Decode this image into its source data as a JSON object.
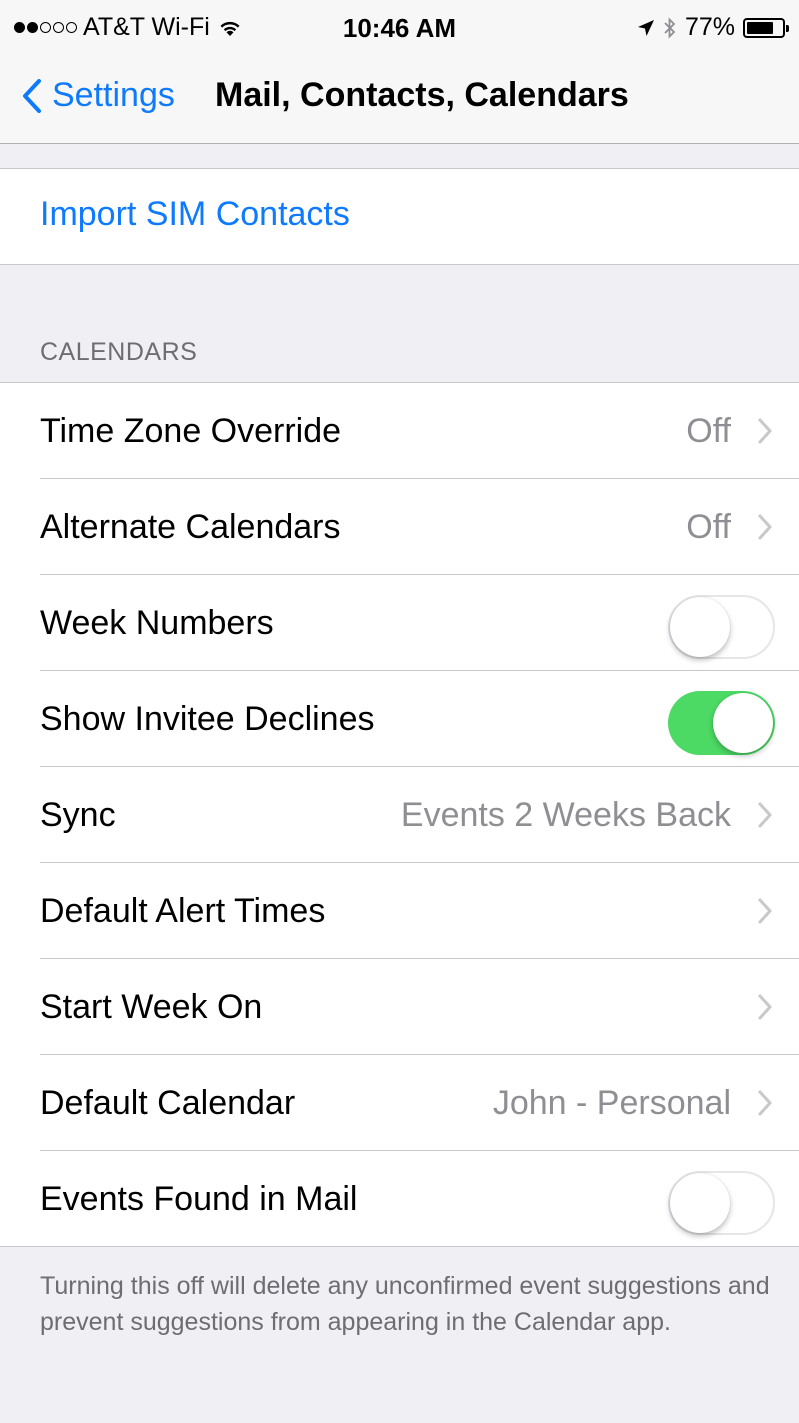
{
  "status_bar": {
    "signal_dots": [
      true,
      true,
      false,
      false,
      false
    ],
    "carrier": "AT&T Wi-Fi",
    "wifi_icon": "wifi-icon",
    "time": "10:46 AM",
    "location_icon": "location-arrow-icon",
    "bluetooth_icon": "bluetooth-icon",
    "battery_percent": "77%",
    "battery_level": 0.77
  },
  "nav": {
    "back_label": "Settings",
    "title": "Mail, Contacts, Calendars"
  },
  "import_sim": {
    "label": "Import SIM Contacts"
  },
  "calendars": {
    "header": "CALENDARS",
    "rows": [
      {
        "label": "Time Zone Override",
        "value": "Off"
      },
      {
        "label": "Alternate Calendars",
        "value": "Off"
      },
      {
        "label": "Week Numbers",
        "toggle": false
      },
      {
        "label": "Show Invitee Declines",
        "toggle": true
      },
      {
        "label": "Sync",
        "value": "Events 2 Weeks Back"
      },
      {
        "label": "Default Alert Times",
        "value": ""
      },
      {
        "label": "Start Week On",
        "value": ""
      },
      {
        "label": "Default Calendar",
        "value": "John - Personal"
      },
      {
        "label": "Events Found in Mail",
        "toggle": false
      }
    ],
    "footer": "Turning this off will delete any unconfirmed event suggestions and prevent suggestions from appearing in the Calendar app."
  },
  "colors": {
    "accent": "#0e7afe",
    "toggle_on": "#4cd964",
    "secondary_text": "#8e8e93",
    "background": "#efeff4"
  }
}
